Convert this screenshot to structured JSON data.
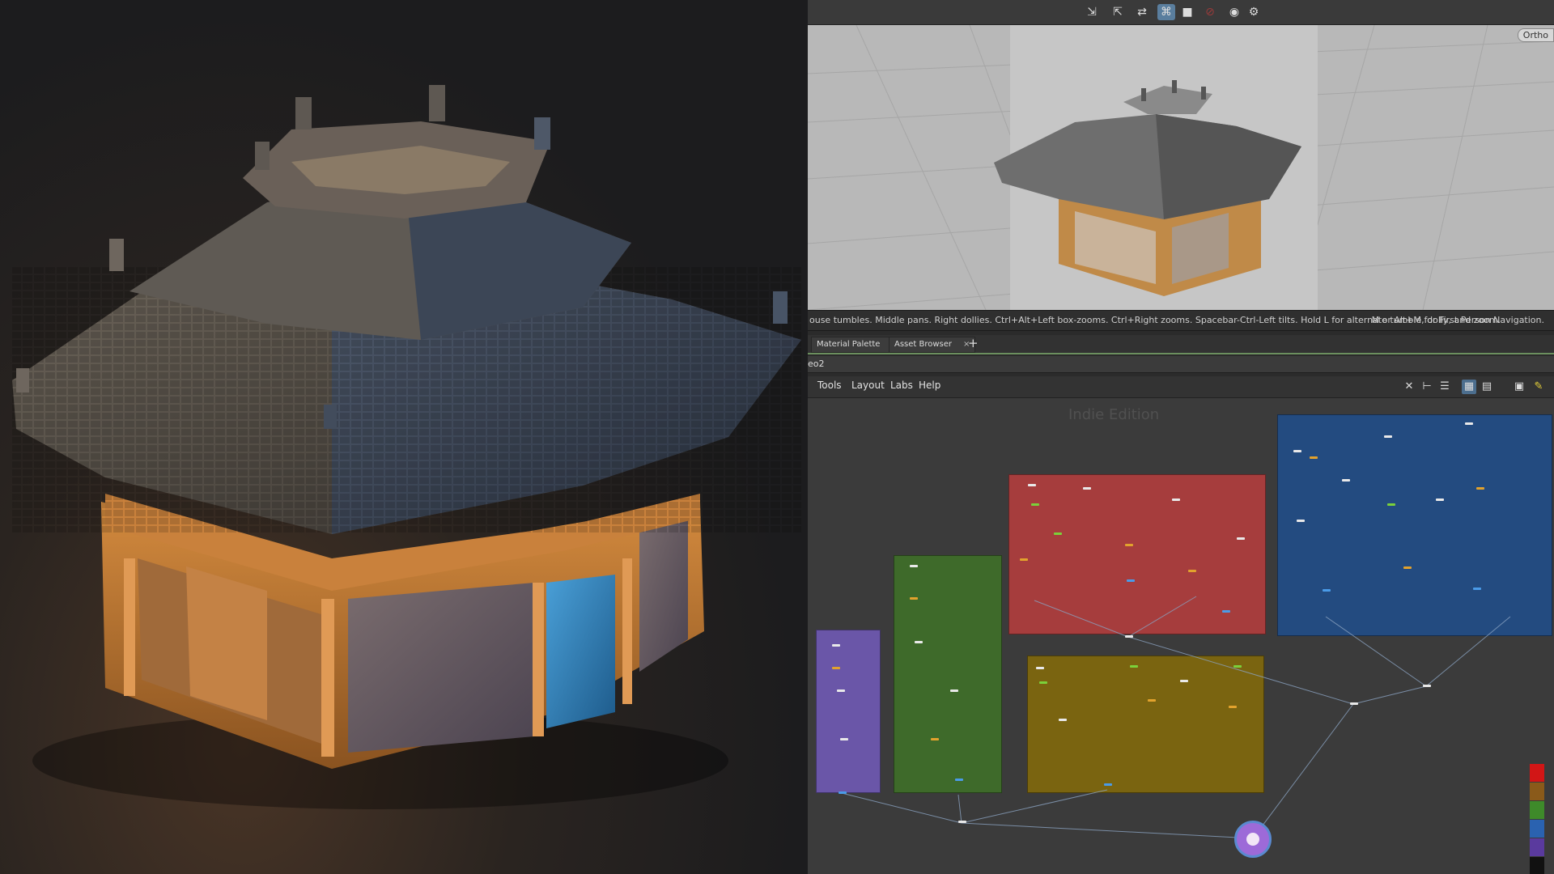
{
  "viewport": {
    "ortho_label": "Ortho"
  },
  "status_bar": {
    "hint_text": "ouse tumbles. Middle pans. Right dollies. Ctrl+Alt+Left box-zooms. Ctrl+Right zooms. Spacebar-Ctrl-Left tilts. Hold L for alternate tumble, dolly, and zoom.",
    "nav_text": "M or Alt+M for First Person Navigation."
  },
  "pane_tabs": {
    "tabs": [
      {
        "label": "Material Palette",
        "close": "×"
      },
      {
        "label": "Asset Browser",
        "close": "×"
      }
    ],
    "add_label": "+"
  },
  "path_bar": {
    "path": "eo2"
  },
  "network_menu": {
    "items": [
      "Tools",
      "Layout",
      "Labs",
      "Help"
    ]
  },
  "network": {
    "watermark": "Indie Edition",
    "box_colors": {
      "purple": "#6a56a8",
      "green": "#3e6a2a",
      "red": "#a63d3d",
      "olive": "#7a6410",
      "blue": "#234b80"
    }
  },
  "color_swatches": [
    "#d21616",
    "#8a5a1a",
    "#3e8a2a",
    "#2a62b0",
    "#5a3a9e",
    "#111111"
  ],
  "icons": {
    "toolbar": [
      "select-icon",
      "pose-icon",
      "transform-icon",
      "snap-icon",
      "record-icon",
      "no-entry-icon",
      "camera-icon",
      "settings-icon"
    ],
    "menubar": [
      "wrench-icon",
      "tree-icon",
      "list-icon",
      "grid-icon",
      "table-icon",
      "window-icon",
      "sticky-note-icon"
    ]
  }
}
